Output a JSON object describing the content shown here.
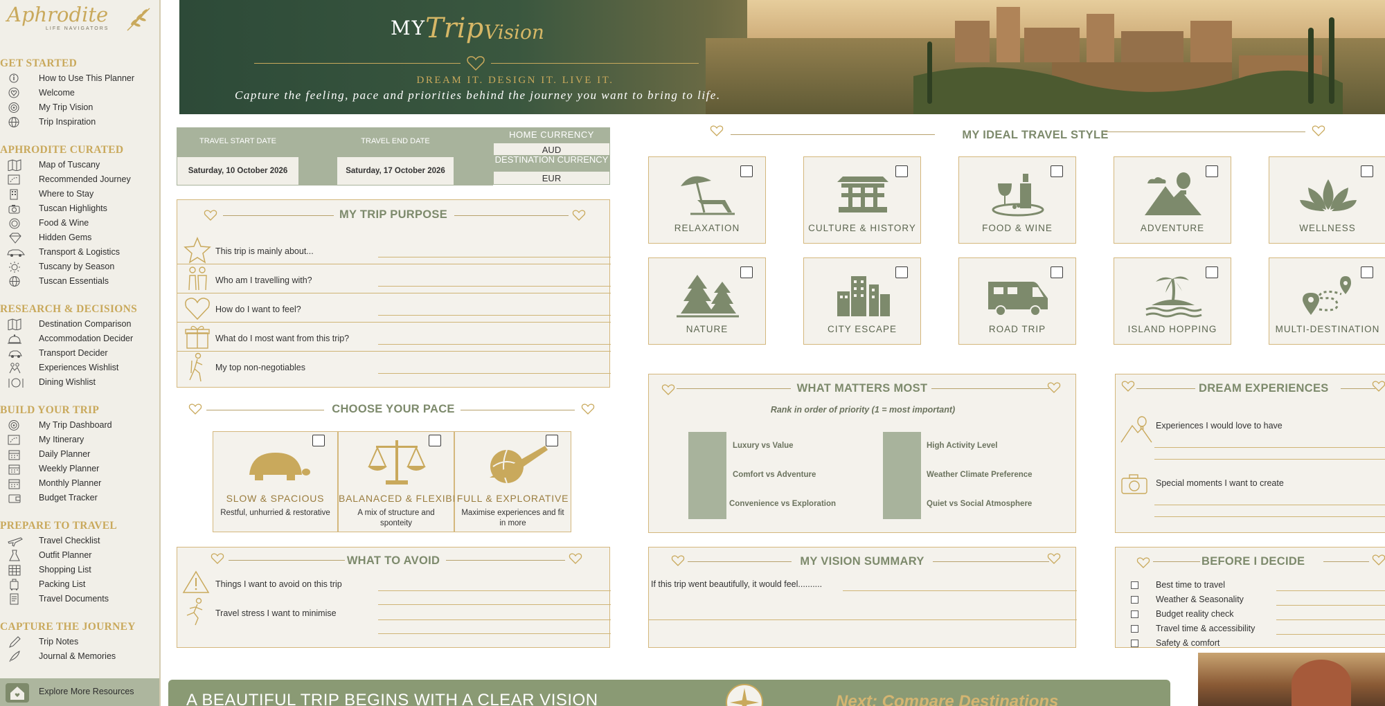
{
  "brand": {
    "name": "Aphrodite",
    "subtitle": "LIFE NAVIGATORS"
  },
  "sidebar": {
    "sections": [
      {
        "title": "GET STARTED",
        "items": [
          {
            "label": "How to Use This Planner",
            "icon": "info-icon"
          },
          {
            "label": "Welcome",
            "icon": "heart-icon"
          },
          {
            "label": "My Trip Vision",
            "icon": "target-icon"
          },
          {
            "label": "Trip Inspiration",
            "icon": "globe-icon"
          }
        ]
      },
      {
        "title": "APHRODITE CURATED",
        "items": [
          {
            "label": "Map of Tuscany",
            "icon": "map-icon"
          },
          {
            "label": "Recommended Journey",
            "icon": "route-icon"
          },
          {
            "label": "Where to Stay",
            "icon": "hotel-icon"
          },
          {
            "label": "Tuscan Highlights",
            "icon": "camera-icon"
          },
          {
            "label": "Food & Wine",
            "icon": "plate-icon"
          },
          {
            "label": "Hidden Gems",
            "icon": "gem-icon"
          },
          {
            "label": "Transport & Logistics",
            "icon": "car-icon"
          },
          {
            "label": "Tuscany by Season",
            "icon": "sun-icon"
          },
          {
            "label": "Tuscan Essentials",
            "icon": "globe-icon"
          }
        ]
      },
      {
        "title": "RESEARCH & DECISIONS",
        "items": [
          {
            "label": "Destination Comparison",
            "icon": "map-icon"
          },
          {
            "label": "Accommodation Decider",
            "icon": "bell-icon"
          },
          {
            "label": "Transport Decider",
            "icon": "car-icon"
          },
          {
            "label": "Experiences Wishlist",
            "icon": "people-icon"
          },
          {
            "label": "Dining  Wishlist",
            "icon": "plate-icon"
          }
        ]
      },
      {
        "title": "BUILD YOUR TRIP",
        "items": [
          {
            "label": "My Trip Dashboard",
            "icon": "target-icon"
          },
          {
            "label": "My Itinerary",
            "icon": "route-icon"
          },
          {
            "label": "Daily Planner",
            "icon": "calendar-icon"
          },
          {
            "label": "Weekly Planner",
            "icon": "calendar-icon"
          },
          {
            "label": "Monthly Planner",
            "icon": "calendar-icon"
          },
          {
            "label": "Budget Tracker",
            "icon": "wallet-icon"
          }
        ]
      },
      {
        "title": "PREPARE TO TRAVEL",
        "items": [
          {
            "label": "Travel Checklist",
            "icon": "plane-icon"
          },
          {
            "label": "Outfit Planner",
            "icon": "dress-icon"
          },
          {
            "label": "Shopping List",
            "icon": "grid-icon"
          },
          {
            "label": "Packing List",
            "icon": "suitcase-icon"
          },
          {
            "label": "Travel Documents",
            "icon": "document-icon"
          }
        ]
      },
      {
        "title": "CAPTURE THE JOURNEY",
        "items": [
          {
            "label": "Trip Notes",
            "icon": "pen-icon"
          },
          {
            "label": "Journal & Memories",
            "icon": "quill-icon"
          }
        ]
      }
    ],
    "explore": "Explore More Resources"
  },
  "banner": {
    "my": "MY",
    "trip": "Trip",
    "vision": "Vision",
    "tagline": "DREAM IT. DESIGN IT. LIVE IT.",
    "caption": "Capture the feeling, pace and priorities behind the journey you want to bring to life."
  },
  "dates": {
    "start_label": "TRAVEL START DATE",
    "start_value": "Saturday, 10 October 2026",
    "end_label": "TRAVEL END DATE",
    "end_value": "Saturday, 17 October 2026",
    "home_currency_label": "HOME CURRENCY",
    "home_currency_value": "AUD",
    "dest_currency_label": "DESTINATION CURRENCY",
    "dest_currency_value": "EUR"
  },
  "purpose": {
    "title": "MY TRIP PURPOSE",
    "rows": [
      {
        "label": "This trip is mainly about...",
        "icon": "star-icon"
      },
      {
        "label": "Who am I travelling with?",
        "icon": "couple-icon"
      },
      {
        "label": "How do I want to feel?",
        "icon": "heart-icon"
      },
      {
        "label": "What do I most want from this trip?",
        "icon": "gift-icon"
      },
      {
        "label": "My top non-negotiables",
        "icon": "hiker-icon"
      }
    ]
  },
  "pace": {
    "title": "CHOOSE YOUR PACE",
    "options": [
      {
        "label": "SLOW & SPACIOUS",
        "desc": "Restful, unhurried & restorative",
        "icon": "turtle-icon"
      },
      {
        "label": "BALANACED & FLEXIBLE",
        "desc": "A mix of structure and sponteity",
        "icon": "scales-icon"
      },
      {
        "label": "FULL & EXPLORATIVE",
        "desc": "Maximise experiences and fit in more",
        "icon": "plane-globe-icon"
      }
    ]
  },
  "avoid": {
    "title": "WHAT TO AVOID",
    "rows": [
      {
        "label": "Things I want to avoid on this trip",
        "icon": "warning-icon"
      },
      {
        "label": "Travel stress I want to minimise",
        "icon": "runner-icon"
      }
    ]
  },
  "style": {
    "title": "MY IDEAL TRAVEL STYLE",
    "cards": [
      {
        "label": "RELAXATION",
        "icon": "beach-umbrella-icon"
      },
      {
        "label": "CULTURE & HISTORY",
        "icon": "temple-icon"
      },
      {
        "label": "FOOD & WINE",
        "icon": "wine-icon"
      },
      {
        "label": "ADVENTURE",
        "icon": "mountain-balloon-icon"
      },
      {
        "label": "WELLNESS",
        "icon": "lotus-icon"
      },
      {
        "label": "NATURE",
        "icon": "trees-icon"
      },
      {
        "label": "CITY ESCAPE",
        "icon": "city-icon"
      },
      {
        "label": "ROAD TRIP",
        "icon": "campervan-icon"
      },
      {
        "label": "ISLAND HOPPING",
        "icon": "island-icon"
      },
      {
        "label": "MULTI-DESTINATION",
        "icon": "route-pins-icon"
      }
    ]
  },
  "matters": {
    "title": "WHAT MATTERS MOST",
    "subtitle": "Rank in order of priority (1 = most important)",
    "left": [
      "Luxury vs Value",
      "Comfort vs Adventure",
      "Convenience vs Exploration"
    ],
    "right": [
      "High Activity Level",
      "Weather Climate Preference",
      "Quiet vs Social Atmosphere"
    ]
  },
  "dream": {
    "title": "DREAM EXPERIENCES",
    "rows": [
      {
        "label": "Experiences I would love to have",
        "icon": "mountain-balloon-icon"
      },
      {
        "label": "Special moments I want to create",
        "icon": "camera-icon"
      }
    ]
  },
  "summary": {
    "title": "MY VISION SUMMARY",
    "prompt": "If this trip went beautifully, it would feel.........."
  },
  "decide": {
    "title": "BEFORE I DECIDE",
    "items": [
      "Best time to travel",
      "Weather & Seasonality",
      "Budget reality check",
      "Travel time & accessibility",
      "Safety & comfort"
    ]
  },
  "footer": {
    "title": "A BEAUTIFUL TRIP BEGINS WITH A CLEAR VISION",
    "next": "Next: Compare Destinations"
  },
  "colors": {
    "sage": "#a8b39c",
    "gold": "#c9a95c",
    "olive": "#7d8a6c",
    "cream": "#f4f2ec"
  }
}
